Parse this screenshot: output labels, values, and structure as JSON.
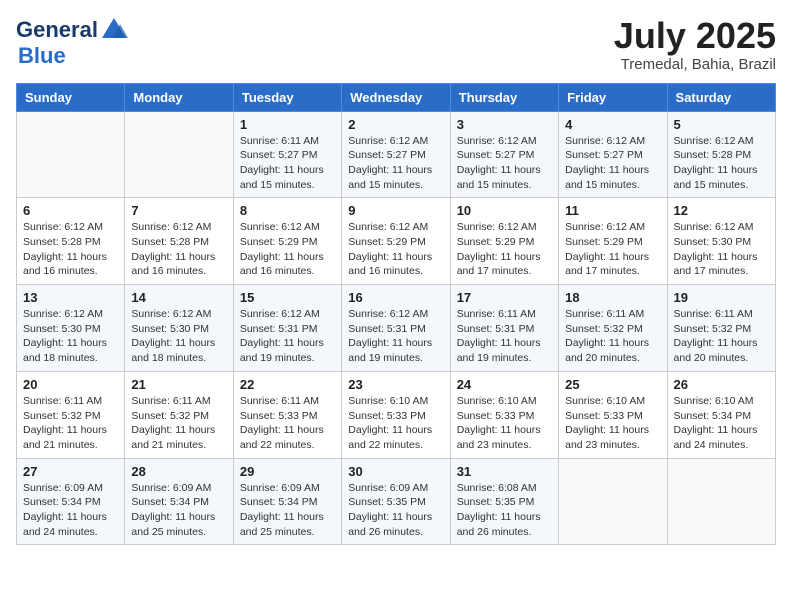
{
  "header": {
    "logo_line1": "General",
    "logo_line2": "Blue",
    "month_title": "July 2025",
    "subtitle": "Tremedal, Bahia, Brazil"
  },
  "weekdays": [
    "Sunday",
    "Monday",
    "Tuesday",
    "Wednesday",
    "Thursday",
    "Friday",
    "Saturday"
  ],
  "weeks": [
    [
      {
        "day": "",
        "sunrise": "",
        "sunset": "",
        "daylight": ""
      },
      {
        "day": "",
        "sunrise": "",
        "sunset": "",
        "daylight": ""
      },
      {
        "day": "1",
        "sunrise": "Sunrise: 6:11 AM",
        "sunset": "Sunset: 5:27 PM",
        "daylight": "Daylight: 11 hours and 15 minutes."
      },
      {
        "day": "2",
        "sunrise": "Sunrise: 6:12 AM",
        "sunset": "Sunset: 5:27 PM",
        "daylight": "Daylight: 11 hours and 15 minutes."
      },
      {
        "day": "3",
        "sunrise": "Sunrise: 6:12 AM",
        "sunset": "Sunset: 5:27 PM",
        "daylight": "Daylight: 11 hours and 15 minutes."
      },
      {
        "day": "4",
        "sunrise": "Sunrise: 6:12 AM",
        "sunset": "Sunset: 5:27 PM",
        "daylight": "Daylight: 11 hours and 15 minutes."
      },
      {
        "day": "5",
        "sunrise": "Sunrise: 6:12 AM",
        "sunset": "Sunset: 5:28 PM",
        "daylight": "Daylight: 11 hours and 15 minutes."
      }
    ],
    [
      {
        "day": "6",
        "sunrise": "Sunrise: 6:12 AM",
        "sunset": "Sunset: 5:28 PM",
        "daylight": "Daylight: 11 hours and 16 minutes."
      },
      {
        "day": "7",
        "sunrise": "Sunrise: 6:12 AM",
        "sunset": "Sunset: 5:28 PM",
        "daylight": "Daylight: 11 hours and 16 minutes."
      },
      {
        "day": "8",
        "sunrise": "Sunrise: 6:12 AM",
        "sunset": "Sunset: 5:29 PM",
        "daylight": "Daylight: 11 hours and 16 minutes."
      },
      {
        "day": "9",
        "sunrise": "Sunrise: 6:12 AM",
        "sunset": "Sunset: 5:29 PM",
        "daylight": "Daylight: 11 hours and 16 minutes."
      },
      {
        "day": "10",
        "sunrise": "Sunrise: 6:12 AM",
        "sunset": "Sunset: 5:29 PM",
        "daylight": "Daylight: 11 hours and 17 minutes."
      },
      {
        "day": "11",
        "sunrise": "Sunrise: 6:12 AM",
        "sunset": "Sunset: 5:29 PM",
        "daylight": "Daylight: 11 hours and 17 minutes."
      },
      {
        "day": "12",
        "sunrise": "Sunrise: 6:12 AM",
        "sunset": "Sunset: 5:30 PM",
        "daylight": "Daylight: 11 hours and 17 minutes."
      }
    ],
    [
      {
        "day": "13",
        "sunrise": "Sunrise: 6:12 AM",
        "sunset": "Sunset: 5:30 PM",
        "daylight": "Daylight: 11 hours and 18 minutes."
      },
      {
        "day": "14",
        "sunrise": "Sunrise: 6:12 AM",
        "sunset": "Sunset: 5:30 PM",
        "daylight": "Daylight: 11 hours and 18 minutes."
      },
      {
        "day": "15",
        "sunrise": "Sunrise: 6:12 AM",
        "sunset": "Sunset: 5:31 PM",
        "daylight": "Daylight: 11 hours and 19 minutes."
      },
      {
        "day": "16",
        "sunrise": "Sunrise: 6:12 AM",
        "sunset": "Sunset: 5:31 PM",
        "daylight": "Daylight: 11 hours and 19 minutes."
      },
      {
        "day": "17",
        "sunrise": "Sunrise: 6:11 AM",
        "sunset": "Sunset: 5:31 PM",
        "daylight": "Daylight: 11 hours and 19 minutes."
      },
      {
        "day": "18",
        "sunrise": "Sunrise: 6:11 AM",
        "sunset": "Sunset: 5:32 PM",
        "daylight": "Daylight: 11 hours and 20 minutes."
      },
      {
        "day": "19",
        "sunrise": "Sunrise: 6:11 AM",
        "sunset": "Sunset: 5:32 PM",
        "daylight": "Daylight: 11 hours and 20 minutes."
      }
    ],
    [
      {
        "day": "20",
        "sunrise": "Sunrise: 6:11 AM",
        "sunset": "Sunset: 5:32 PM",
        "daylight": "Daylight: 11 hours and 21 minutes."
      },
      {
        "day": "21",
        "sunrise": "Sunrise: 6:11 AM",
        "sunset": "Sunset: 5:32 PM",
        "daylight": "Daylight: 11 hours and 21 minutes."
      },
      {
        "day": "22",
        "sunrise": "Sunrise: 6:11 AM",
        "sunset": "Sunset: 5:33 PM",
        "daylight": "Daylight: 11 hours and 22 minutes."
      },
      {
        "day": "23",
        "sunrise": "Sunrise: 6:10 AM",
        "sunset": "Sunset: 5:33 PM",
        "daylight": "Daylight: 11 hours and 22 minutes."
      },
      {
        "day": "24",
        "sunrise": "Sunrise: 6:10 AM",
        "sunset": "Sunset: 5:33 PM",
        "daylight": "Daylight: 11 hours and 23 minutes."
      },
      {
        "day": "25",
        "sunrise": "Sunrise: 6:10 AM",
        "sunset": "Sunset: 5:33 PM",
        "daylight": "Daylight: 11 hours and 23 minutes."
      },
      {
        "day": "26",
        "sunrise": "Sunrise: 6:10 AM",
        "sunset": "Sunset: 5:34 PM",
        "daylight": "Daylight: 11 hours and 24 minutes."
      }
    ],
    [
      {
        "day": "27",
        "sunrise": "Sunrise: 6:09 AM",
        "sunset": "Sunset: 5:34 PM",
        "daylight": "Daylight: 11 hours and 24 minutes."
      },
      {
        "day": "28",
        "sunrise": "Sunrise: 6:09 AM",
        "sunset": "Sunset: 5:34 PM",
        "daylight": "Daylight: 11 hours and 25 minutes."
      },
      {
        "day": "29",
        "sunrise": "Sunrise: 6:09 AM",
        "sunset": "Sunset: 5:34 PM",
        "daylight": "Daylight: 11 hours and 25 minutes."
      },
      {
        "day": "30",
        "sunrise": "Sunrise: 6:09 AM",
        "sunset": "Sunset: 5:35 PM",
        "daylight": "Daylight: 11 hours and 26 minutes."
      },
      {
        "day": "31",
        "sunrise": "Sunrise: 6:08 AM",
        "sunset": "Sunset: 5:35 PM",
        "daylight": "Daylight: 11 hours and 26 minutes."
      },
      {
        "day": "",
        "sunrise": "",
        "sunset": "",
        "daylight": ""
      },
      {
        "day": "",
        "sunrise": "",
        "sunset": "",
        "daylight": ""
      }
    ]
  ]
}
